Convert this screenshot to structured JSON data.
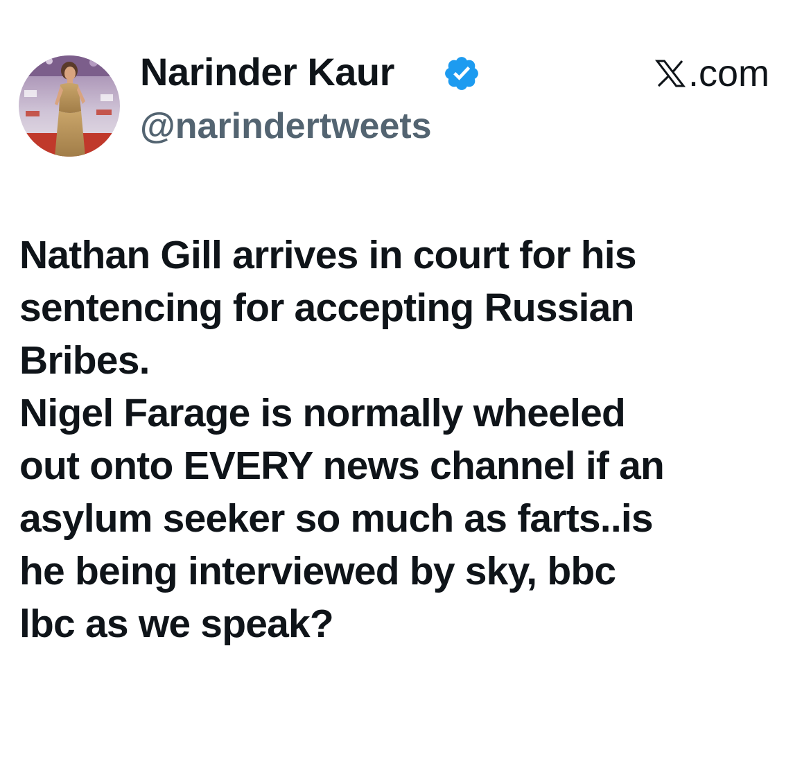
{
  "tweet": {
    "author": {
      "display_name": "Narinder Kaur",
      "handle": "@narindertweets",
      "verified": true,
      "badge_color": "#1d9bf0"
    },
    "site": {
      "logo_icon": "x-logo-icon",
      "label": ".com"
    },
    "text_lines": [
      "Nathan Gill arrives in court for his",
      "sentencing for accepting Russian",
      "Bribes.",
      "Nigel Farage is normally wheeled",
      "out onto EVERY news channel if an",
      "asylum seeker so much as farts..is",
      "he being interviewed by sky, bbc",
      "lbc as we speak?"
    ]
  },
  "colors": {
    "text": "#0f1419",
    "handle": "#536471",
    "background": "#ffffff"
  }
}
